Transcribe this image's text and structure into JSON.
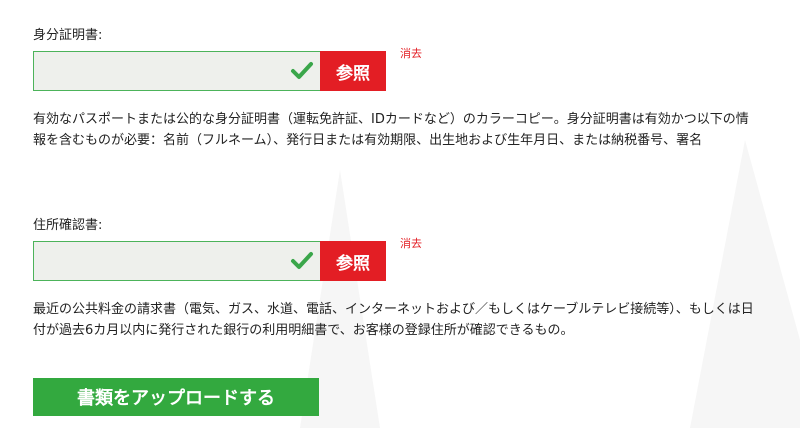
{
  "colors": {
    "accent_red": "#e31e24",
    "success_green": "#33a93f",
    "check_green": "#3aa64a",
    "field_bg": "#eef0ec"
  },
  "identity": {
    "label": "身分証明書:",
    "file_value": "",
    "browse_label": "参照",
    "clear_label": "消去",
    "status_icon": "check-icon",
    "description": "有効なパスポートまたは公的な身分証明書（運転免許証、IDカードなど）のカラーコピー。身分証明書は有効かつ以下の情報を含むものが必要：名前（フルネーム）、発行日または有効期限、出生地および生年月日、または納税番号、署名"
  },
  "address": {
    "label": "住所確認書:",
    "file_value": "",
    "browse_label": "参照",
    "clear_label": "消去",
    "status_icon": "check-icon",
    "description": "最近の公共料金の請求書（電気、ガス、水道、電話、インターネットおよび／もしくはケーブルテレビ接続等）、もしくは日付が過去6カ月以内に発行された銀行の利用明細書で、お客様の登録住所が確認できるもの。"
  },
  "submit_label": "書類をアップロードする"
}
